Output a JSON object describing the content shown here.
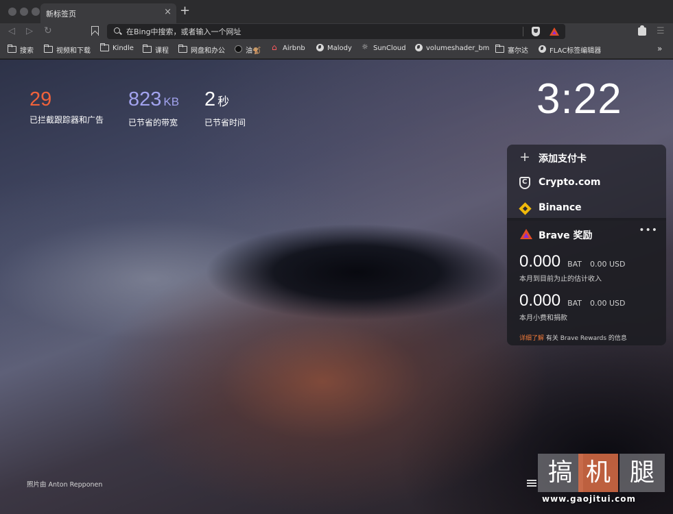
{
  "tab": {
    "title": "新标签页",
    "close": "×",
    "new_tab": "+"
  },
  "toolbar": {
    "back": "◁",
    "forward": "▷",
    "reload": "↻",
    "url_placeholder": "在Bing中搜索，或者输入一个网址",
    "menu": "☰"
  },
  "bookmarks": {
    "items": [
      {
        "label": "搜索",
        "icon": "folder-icon"
      },
      {
        "label": "视频和下载",
        "icon": "folder-icon"
      },
      {
        "label": "Kindle",
        "icon": "folder-icon"
      },
      {
        "label": "课程",
        "icon": "folder-icon"
      },
      {
        "label": "网盘和办公",
        "icon": "folder-icon"
      },
      {
        "label": "油🐒",
        "icon": "site-icon"
      },
      {
        "label": "Airbnb",
        "icon": "airbnb-icon"
      },
      {
        "label": "Malody",
        "icon": "globe-icon"
      },
      {
        "label": "SunCloud",
        "icon": "suncloud-icon"
      },
      {
        "label": "volumeshader_bm",
        "icon": "globe-icon"
      },
      {
        "label": "塞尔达",
        "icon": "folder-icon"
      },
      {
        "label": "FLAC标签编辑器",
        "icon": "globe-icon"
      }
    ],
    "more": "»"
  },
  "stats": {
    "trackers": {
      "value": "29",
      "unit": "",
      "label": "已拦截跟踪器和广告"
    },
    "bandwidth": {
      "value": "823",
      "unit": "KB",
      "label": "已节省的带宽"
    },
    "time": {
      "value": "2",
      "unit": "秒",
      "label": "已节省时间"
    }
  },
  "clock": "3:22",
  "widgets": {
    "add_card": "添加支付卡",
    "crypto": "Crypto.com",
    "binance": "Binance"
  },
  "rewards": {
    "title": "Brave 奖励",
    "more": "•••",
    "earnings": {
      "value": "0.000",
      "currency": "BAT",
      "usd": "0.00 USD",
      "caption": "本月到目前为止的估计收入"
    },
    "tips": {
      "value": "0.000",
      "currency": "BAT",
      "usd": "0.00 USD",
      "caption": "本月小费和捐款"
    },
    "footer_link": "详细了解",
    "footer_text": " 有关 Brave Rewards 的信息"
  },
  "photo_credit": "照片由 Anton Repponen",
  "watermark": {
    "c1": "搞",
    "c2": "机",
    "c3": "腿",
    "url": "www.gaojitui.com"
  },
  "colors": {
    "accent_orange": "#f0623b",
    "accent_purple": "#a2a3ee",
    "link": "#f07a3a",
    "binance": "#f0b90b"
  }
}
